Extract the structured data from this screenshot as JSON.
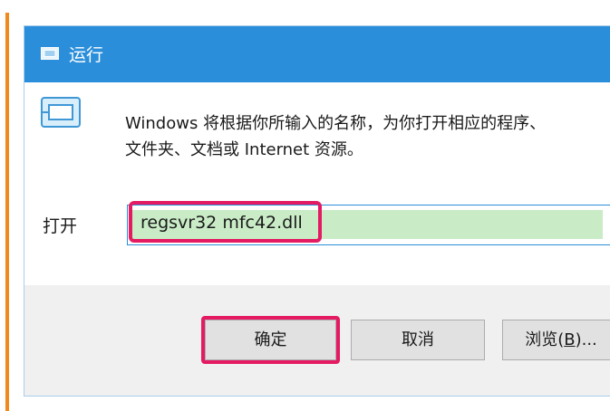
{
  "dialog": {
    "title": "运行",
    "description_line1": "Windows 将根据你所输入的名称，为你打开相应的程序、",
    "description_line2": "文件夹、文档或 Internet 资源。",
    "open_label": "打开",
    "command_value": "regsvr32 mfc42.dll",
    "buttons": {
      "ok": "确定",
      "cancel": "取消",
      "browse_prefix": "浏览(",
      "browse_key": "B",
      "browse_suffix": ")..."
    }
  },
  "colors": {
    "titlebar": "#2b8edb",
    "highlight": "#e41b62",
    "input_fill": "#c9ecc6",
    "accent_left": "#f08a1e"
  },
  "icons": {
    "title": "run-dialog-icon",
    "main": "run-dialog-large-icon"
  }
}
